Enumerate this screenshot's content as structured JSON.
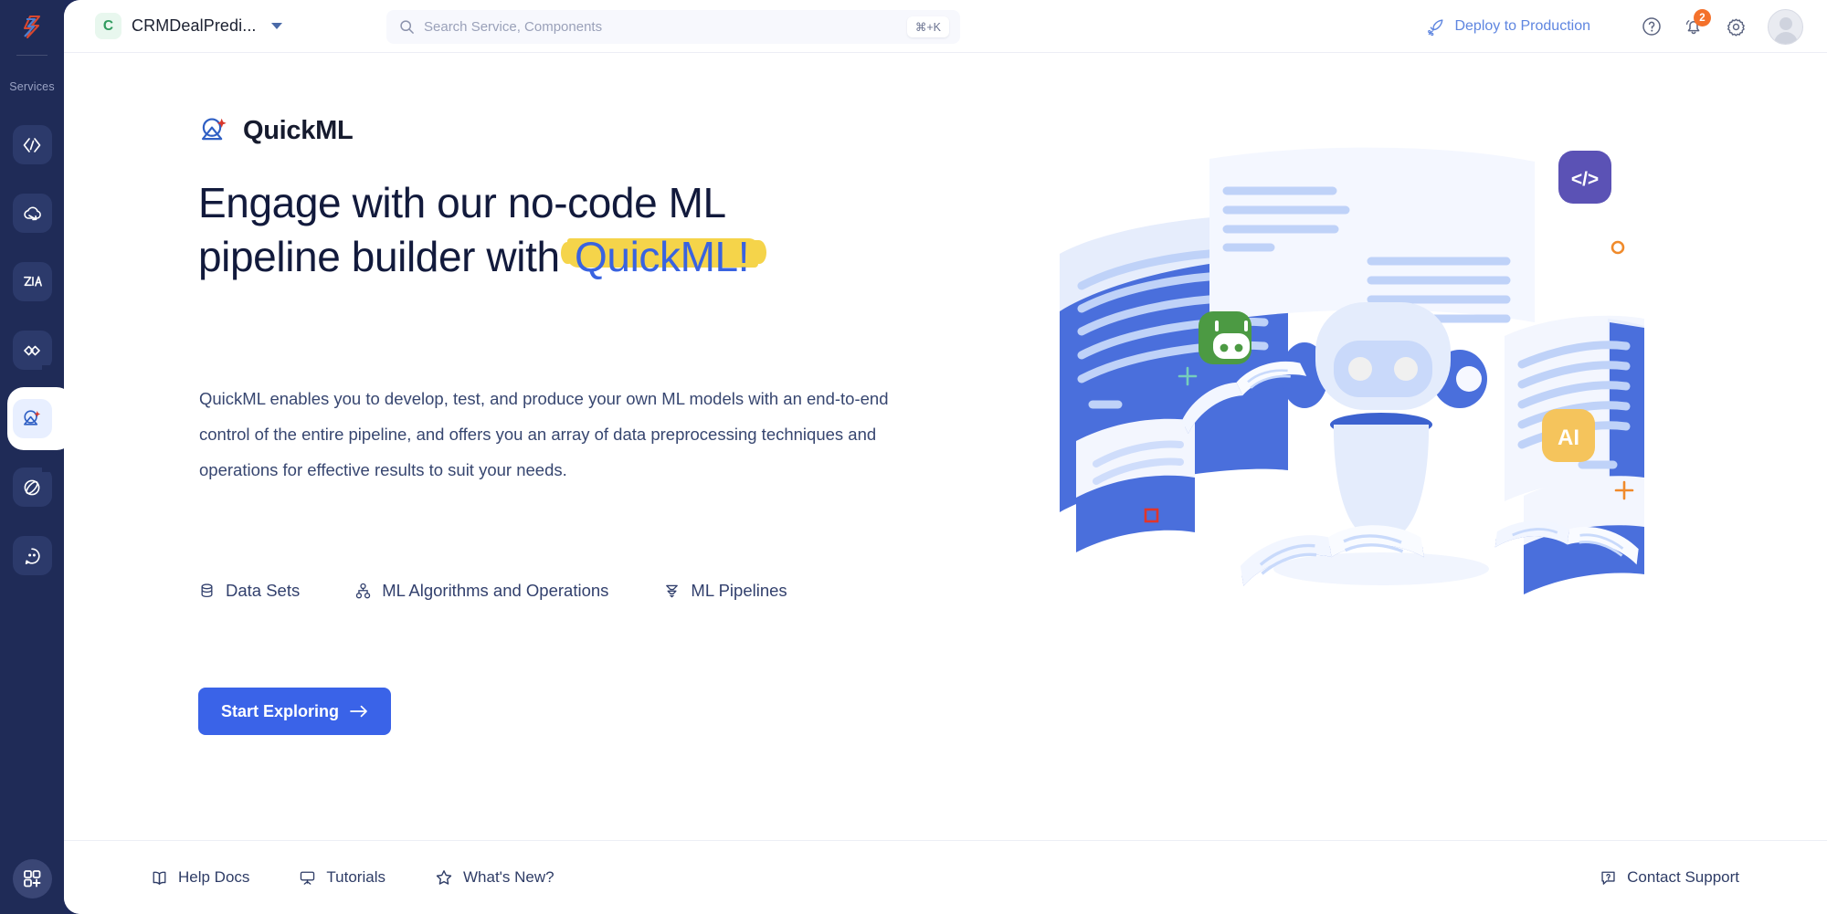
{
  "sidebar": {
    "logo_icon": "zoho-catalyst-logo-icon",
    "section_label": "Services",
    "items": [
      {
        "name": "sidebar-item-code",
        "icon": "code-brackets-icon",
        "active": false
      },
      {
        "name": "sidebar-item-cloud-scale",
        "icon": "cloud-scale-icon",
        "active": false
      },
      {
        "name": "sidebar-item-zia",
        "icon": "zia-icon",
        "active": false
      },
      {
        "name": "sidebar-item-integrations",
        "icon": "link-chain-icon",
        "active": false
      },
      {
        "name": "sidebar-item-quickml",
        "icon": "quickml-satellite-icon",
        "active": true
      },
      {
        "name": "sidebar-item-orbit",
        "icon": "orbit-icon",
        "active": false
      },
      {
        "name": "sidebar-item-bot",
        "icon": "chat-bot-icon",
        "active": false
      }
    ],
    "bottom_button": {
      "name": "all-apps-button",
      "icon": "grid-plus-icon"
    }
  },
  "header": {
    "service": {
      "initial": "C",
      "name": "CRMDealPredi...",
      "caret_icon": "chevron-down-icon"
    },
    "search": {
      "icon": "search-icon",
      "placeholder": "Search Service, Components",
      "value": "",
      "shortcut": "⌘+K"
    },
    "deploy": {
      "icon": "rocket-icon",
      "label": "Deploy to Production"
    },
    "help_icon": "help-circle-icon",
    "notifications": {
      "icon": "bell-icon",
      "badge": "2"
    },
    "settings_icon": "gear-icon",
    "avatar": "user-avatar"
  },
  "main": {
    "brand": {
      "logo_icon": "quickml-satellite-icon",
      "name": "QuickML"
    },
    "headline": {
      "line1": "Engage with our no-code ML",
      "line2_prefix": "pipeline builder with ",
      "highlight": "QuickML!"
    },
    "paragraph": "QuickML enables you to develop, test, and produce your own ML models with an end-to-end control of the entire pipeline, and offers you an array of data preprocessing techniques and operations for effective results to suit your needs.",
    "features": [
      {
        "icon": "database-icon",
        "label": "Data Sets"
      },
      {
        "icon": "algorithm-nodes-icon",
        "label": "ML Algorithms and Operations"
      },
      {
        "icon": "pipeline-funnel-icon",
        "label": "ML Pipelines"
      }
    ],
    "cta": {
      "label": "Start Exploring",
      "icon": "arrow-right-icon"
    },
    "illustration": {
      "name": "ml-robot-documents-illustration",
      "badges": [
        {
          "name": "code-badge",
          "label": "</>",
          "color": "#5b52b5"
        },
        {
          "name": "bot-badge",
          "label": "",
          "color": "#4c9a43"
        },
        {
          "name": "ai-badge",
          "label": "AI",
          "color": "#f5c45c"
        }
      ]
    }
  },
  "footer": {
    "links": [
      {
        "icon": "book-icon",
        "label": "Help Docs"
      },
      {
        "icon": "presentation-icon",
        "label": "Tutorials"
      },
      {
        "icon": "star-icon",
        "label": "What's New?"
      }
    ],
    "support": {
      "icon": "chat-question-icon",
      "label": "Contact Support"
    }
  },
  "colors": {
    "sidebar_bg": "#1f2b57",
    "accent_blue": "#3a63e8",
    "link_blue": "#5f86e0",
    "highlight_yellow": "#f5d44a",
    "badge_orange": "#f4712b",
    "text_dark": "#121a3c"
  }
}
